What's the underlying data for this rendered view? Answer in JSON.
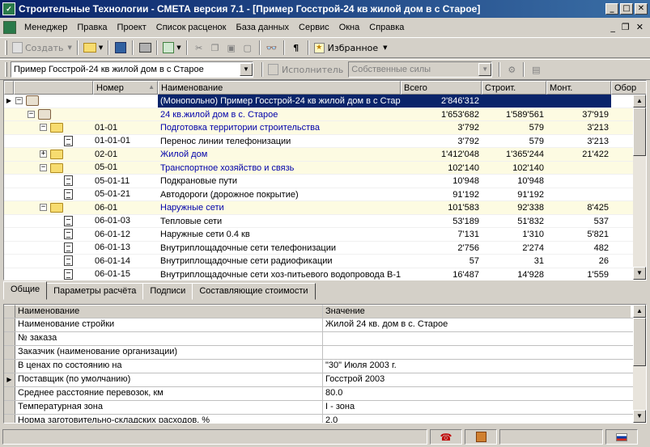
{
  "window": {
    "title": "Строительные Технологии - СМЕТА  версия 7.1 - [Пример Госстрой-24 кв жилой дом в с Старое]",
    "btn_min": "_",
    "btn_max": "□",
    "btn_close": "✕",
    "mdi_min": "_",
    "mdi_restore": "❐",
    "mdi_close": "✕"
  },
  "menu": [
    "Менеджер",
    "Правка",
    "Проект",
    "Список расценок",
    "База данных",
    "Сервис",
    "Окна",
    "Справка"
  ],
  "toolbar1": {
    "create_label": "Создать",
    "favorites_label": "Избранное"
  },
  "toolbar2": {
    "project_combo": "Пример Госстрой-24 кв жилой дом в с Старое",
    "executor_label": "Исполнитель",
    "executor_combo": "Собственные силы"
  },
  "grid": {
    "columns": {
      "num": "Номер",
      "name": "Наименование",
      "total": "Всего",
      "build": "Строит.",
      "mont": "Монт.",
      "obor": "Обор"
    },
    "rows": [
      {
        "level": 0,
        "icon": "book",
        "box": "−",
        "num": "",
        "name": "(Монопольно) Пример Госстрой-24 кв жилой дом в с Стар",
        "total": "2'846'312",
        "build": "",
        "mont": "",
        "style": "selected",
        "marker": "▶"
      },
      {
        "level": 1,
        "icon": "book",
        "box": "−",
        "num": "",
        "name": "24 кв.жилой дом в с. Старое",
        "total": "1'653'682",
        "build": "1'589'561",
        "mont": "37'919",
        "style": "yellow"
      },
      {
        "level": 2,
        "icon": "folder",
        "box": "−",
        "num": "01-01",
        "name": "Подготовка территории строительства",
        "total": "3'792",
        "build": "579",
        "mont": "3'213",
        "style": "yellow"
      },
      {
        "level": 3,
        "icon": "doc",
        "box": "",
        "num": "01-01-01",
        "name": "Перенос линии телефонизации",
        "total": "3'792",
        "build": "579",
        "mont": "3'213",
        "style": ""
      },
      {
        "level": 2,
        "icon": "folder",
        "box": "+",
        "num": "02-01",
        "name": "Жилой дом",
        "total": "1'412'048",
        "build": "1'365'244",
        "mont": "21'422",
        "style": "yellow"
      },
      {
        "level": 2,
        "icon": "folder",
        "box": "−",
        "num": "05-01",
        "name": "Транспортное хозяйство и связь",
        "total": "102'140",
        "build": "102'140",
        "mont": "",
        "style": "yellow"
      },
      {
        "level": 3,
        "icon": "doc",
        "box": "",
        "num": "05-01-11",
        "name": "Подкрановые пути",
        "total": "10'948",
        "build": "10'948",
        "mont": "",
        "style": ""
      },
      {
        "level": 3,
        "icon": "doc",
        "box": "",
        "num": "05-01-21",
        "name": "Автодороги (дорожное покрытие)",
        "total": "91'192",
        "build": "91'192",
        "mont": "",
        "style": ""
      },
      {
        "level": 2,
        "icon": "folder",
        "box": "−",
        "num": "06-01",
        "name": "Наружные сети",
        "total": "101'583",
        "build": "92'338",
        "mont": "8'425",
        "style": "yellow"
      },
      {
        "level": 3,
        "icon": "doc",
        "box": "",
        "num": "06-01-03",
        "name": "Тепловые сети",
        "total": "53'189",
        "build": "51'832",
        "mont": "537",
        "style": ""
      },
      {
        "level": 3,
        "icon": "doc",
        "box": "",
        "num": "06-01-12",
        "name": "Наружные сети 0.4 кв",
        "total": "7'131",
        "build": "1'310",
        "mont": "5'821",
        "style": ""
      },
      {
        "level": 3,
        "icon": "doc",
        "box": "",
        "num": "06-01-13",
        "name": "Внутриплощадочные сети телефонизации",
        "total": "2'756",
        "build": "2'274",
        "mont": "482",
        "style": ""
      },
      {
        "level": 3,
        "icon": "doc",
        "box": "",
        "num": "06-01-14",
        "name": "Внутриплощадочные сети радиофикации",
        "total": "57",
        "build": "31",
        "mont": "26",
        "style": ""
      },
      {
        "level": 3,
        "icon": "doc",
        "box": "",
        "num": "06-01-15",
        "name": "Внутриплощадочные сети хоз-питьевого водопровода В-1",
        "total": "16'487",
        "build": "14'928",
        "mont": "1'559",
        "style": ""
      }
    ]
  },
  "tabs": [
    "Общие",
    "Параметры расчёта",
    "Подписи",
    "Составляющие стоимости"
  ],
  "props": {
    "col_name": "Наименование",
    "col_value": "Значение",
    "rows": [
      {
        "name": "Наименование стройки",
        "value": "Жилой 24 кв. дом в с. Старое",
        "marker": ""
      },
      {
        "name": "№ заказа",
        "value": "",
        "marker": ""
      },
      {
        "name": "Заказчик (наименование организации)",
        "value": "",
        "marker": ""
      },
      {
        "name": "В ценах по состоянию на",
        "value": "\"30\" Июля 2003 г.",
        "marker": ""
      },
      {
        "name": "Поставщик (по умолчанию)",
        "value": "Госстрой 2003",
        "marker": "▶"
      },
      {
        "name": "Среднее расстояние перевозок, км",
        "value": "80.0",
        "marker": ""
      },
      {
        "name": "Температурная зона",
        "value": "I - зона",
        "marker": ""
      },
      {
        "name": "Норма заготовительно-складских расходов, %",
        "value": "2.0",
        "marker": ""
      }
    ]
  },
  "icons": {
    "phone": "phone-icon",
    "package": "package-icon",
    "flag": "flag-icon"
  },
  "colors": {
    "title_start": "#0a246a",
    "selection": "#0a246a",
    "highlight_row": "#fdfbe2",
    "blue_text": "#0000aa"
  }
}
